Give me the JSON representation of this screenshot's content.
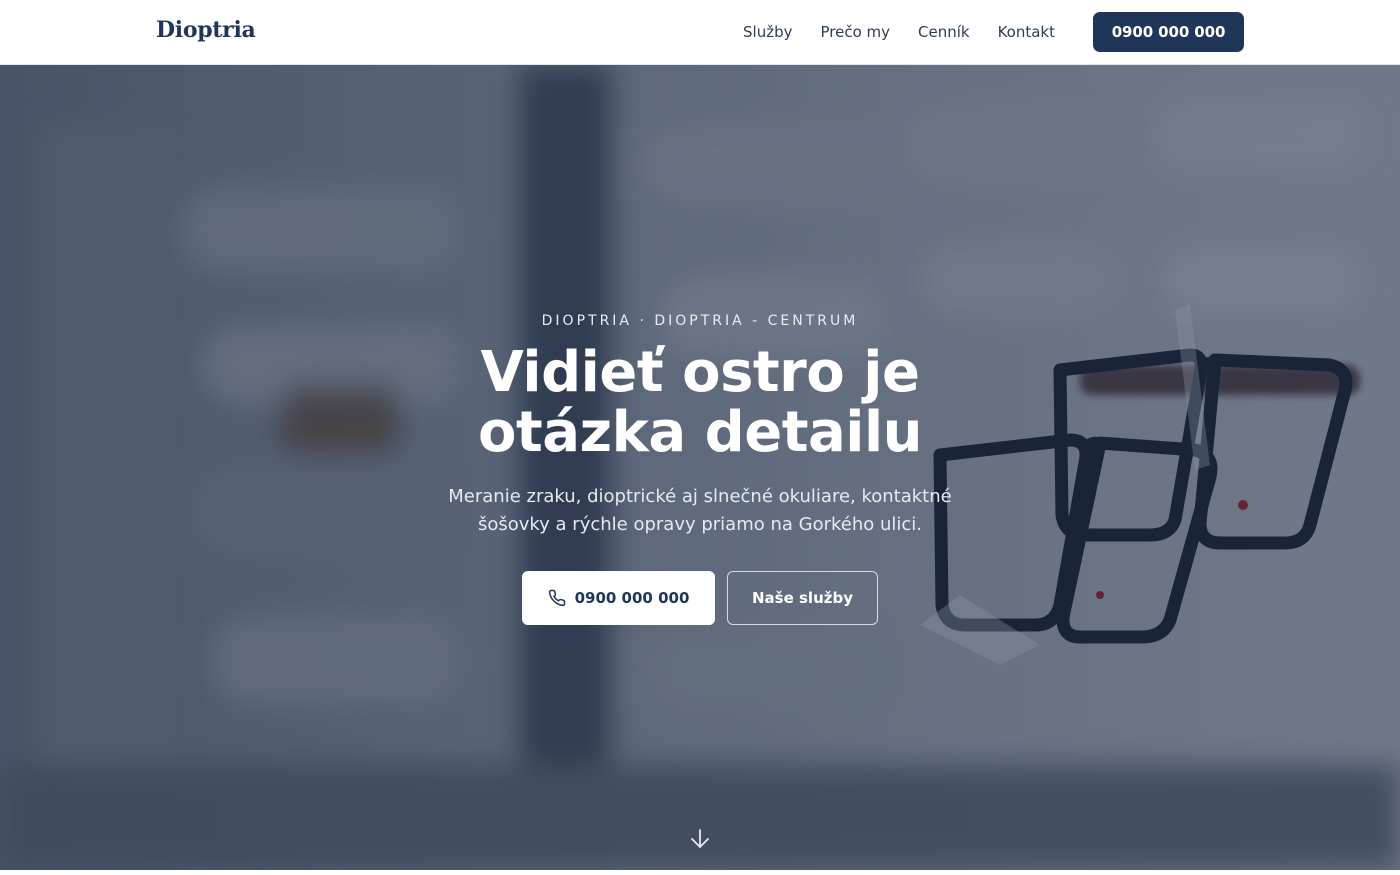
{
  "header": {
    "logo": "Dioptria",
    "nav": [
      {
        "label": "Služby"
      },
      {
        "label": "Prečo my"
      },
      {
        "label": "Cenník"
      },
      {
        "label": "Kontakt"
      }
    ],
    "cta_phone": "0900 000 000"
  },
  "hero": {
    "eyebrow": "DIOPTRIA · DIOPTRIA - CENTRUM",
    "title_line1": "Vidieť ostro je",
    "title_line2": "otázka detailu",
    "subtitle_line1": "Meranie zraku, dioptrické aj slnečné okuliare, kontaktné",
    "subtitle_line2": "šošovky a rýchle opravy priamo na Gorkého ulici.",
    "primary_button": "0900 000 000",
    "secondary_button": "Naše služby"
  },
  "icons": {
    "phone": "phone-icon",
    "scroll": "arrow-down-icon"
  },
  "colors": {
    "brand": "#1f3658",
    "overlay": "#18243a"
  }
}
